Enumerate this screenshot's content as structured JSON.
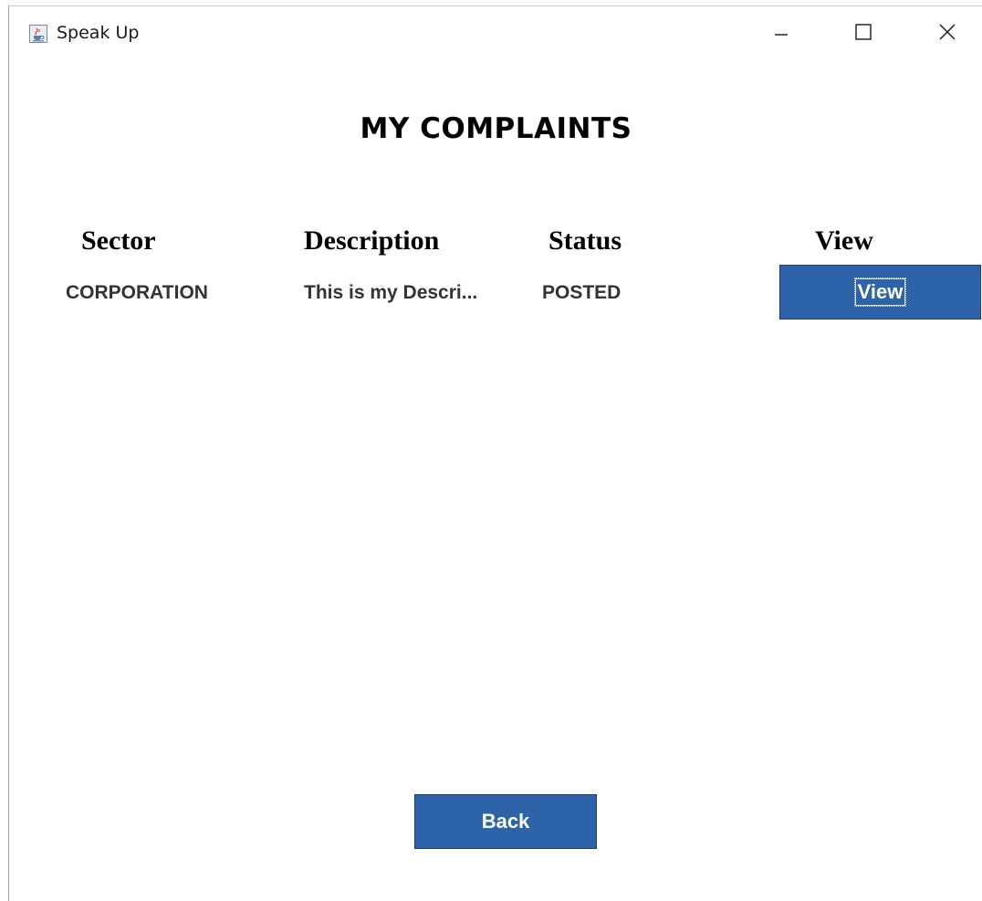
{
  "window": {
    "title": "Speak Up",
    "icon": "java-cup-icon",
    "controls": {
      "minimize_icon": "minimize-icon",
      "maximize_icon": "maximize-icon",
      "close_icon": "close-icon"
    }
  },
  "page": {
    "title": "MY COMPLAINTS"
  },
  "table": {
    "columns": [
      "Sector",
      "Description",
      "Status",
      "View"
    ],
    "rows": [
      {
        "sector": "CORPORATION",
        "description": "This is my Descri...",
        "status": "POSTED",
        "action_label": "View"
      }
    ]
  },
  "footer": {
    "back_label": "Back"
  },
  "colors": {
    "button_bg": "#2d63a8",
    "button_text": "#ffffff",
    "background": "#ffffff"
  }
}
